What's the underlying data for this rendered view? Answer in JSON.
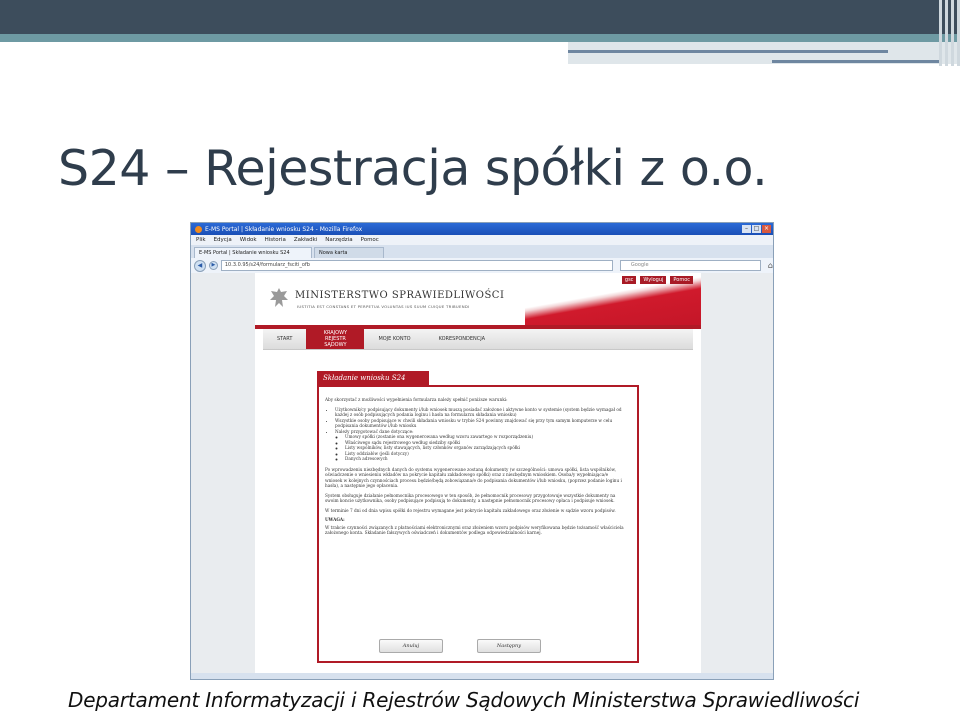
{
  "slide": {
    "title": "S24 – Rejestracja spółki z o.o.",
    "footer": "Departament Informatyzacji i Rejestrów Sądowych Ministerstwa Sprawiedliwości"
  },
  "browser": {
    "window_title": "E-MS Portal | Składanie wniosku S24 - Mozilla Firefox",
    "menu": [
      "Plik",
      "Edycja",
      "Widok",
      "Historia",
      "Zakładki",
      "Narzędzia",
      "Pomoc"
    ],
    "tabs": [
      "E-MS Portal | Składanie wniosku S24",
      "Nowa karta"
    ],
    "url": "10.3.0.95/s24/formularz_fsciti_ofb",
    "search_placeholder": "Google"
  },
  "site": {
    "ministry_name": "MINISTERSTWO SPRAWIEDLIWOŚCI",
    "ministry_motto": "IUSTITIA EST CONSTANS ET PERPETUA VOLUNTAS IUS SUUM CUIQUE TRIBUENDI",
    "top_links": [
      "gsc",
      "Wyloguj",
      "Pomoc"
    ],
    "nav": [
      {
        "label": "START"
      },
      {
        "label": "KRAJOWY REJESTR SĄDOWY",
        "active": true
      },
      {
        "label": "MOJE KONTO"
      },
      {
        "label": "KORESPONDENCJA"
      }
    ]
  },
  "form": {
    "tab_title": "Składanie wniosku S24",
    "intro": "Aby skorzystać z możliwości wypełnienia formularza należy spełnić poniższe warunki:",
    "conditions": [
      "Użytkownik/cy podpisujący dokumenty i/lub wniosek muszą posiadać założone i aktywne konto w systemie (system będzie wymagał od każdej z osób podpisujących podania loginu i hasła na formularzu składania wniosku)",
      "Wszystkie osoby podpisujące w chwili składania wniosku w trybie S24 powinny znajdować się przy tym samym komputerze w celu podpisania dokumentów i/lub wniosku",
      "Należy przygotować dane dotyczące:"
    ],
    "sub_conditions": [
      "Umowy spółki (zostanie ona wygenerowana według wzoru zawartego w rozporządzeniu)",
      "Właściwego sądu rejestrowego według siedziby spółki",
      "Listy wspólników, listy stawających, listy członków organów zarządzających spółki",
      "Listy oddziałów (jeśli dotyczy)",
      "Danych adresowych"
    ],
    "para1": "Po wprowadzeniu niezbędnych danych do systemu wygenerowane zostaną dokumenty (w szczególności: umowa spółki, lista wspólników, oświadczenie o wniesieniu wkładów na pokrycie kapitału zakładowego spółki) oraz z niezbędnym wnioskiem. Osoba/y wypełniająca/e wniosek w kolejnych czynnościach procesu będzie/będą zobowiązana/e do podpisania dokumentów i/lub wniosku, (poprzez podanie loginu i hasła), a następnie jego opłacenia.",
    "para2": "System obsługuje działanie pełnomocnika procesowego w ten sposób, że pełnomocnik procesowy przygotowuje wszystkie dokumenty na swoim koncie użytkownika, osoby podpisujące podpisują te dokumenty, a następnie pełnomocnik procesowy opłaca i podpisuje wniosek.",
    "para3": "W terminie 7 dni od dnia wpisu spółki do rejestru wymagane jest pokrycie kapitału zakładowego oraz złożenie w sądzie wzoru podpisów.",
    "warning_label": "UWAGA:",
    "warning_text": "W trakcie czynności związanych z płatnościami elektronicznymi oraz złożeniem wzoru podpisów weryfikowana będzie tożsamość właściciela założonego konta. Składanie fałszywych oświadczeń i dokumentów podlega odpowiedzialności karnej.",
    "cancel_label": "Anuluj",
    "next_label": "Następny"
  }
}
